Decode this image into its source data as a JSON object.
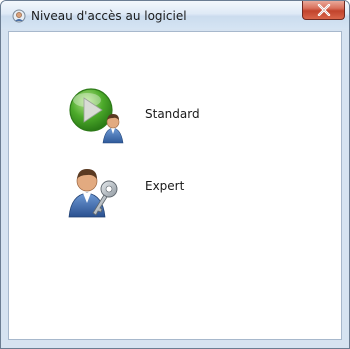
{
  "window": {
    "title": "Niveau d'accès au logiciel",
    "close_icon": "close-icon"
  },
  "options": {
    "standard": {
      "label": "Standard",
      "icon": "play-user-icon"
    },
    "expert": {
      "label": "Expert",
      "icon": "user-key-icon"
    }
  },
  "colors": {
    "titlebar": "#dfeaf6",
    "close_button": "#c2432c",
    "play_green": "#4caa2a",
    "border": "#6b7d92"
  }
}
